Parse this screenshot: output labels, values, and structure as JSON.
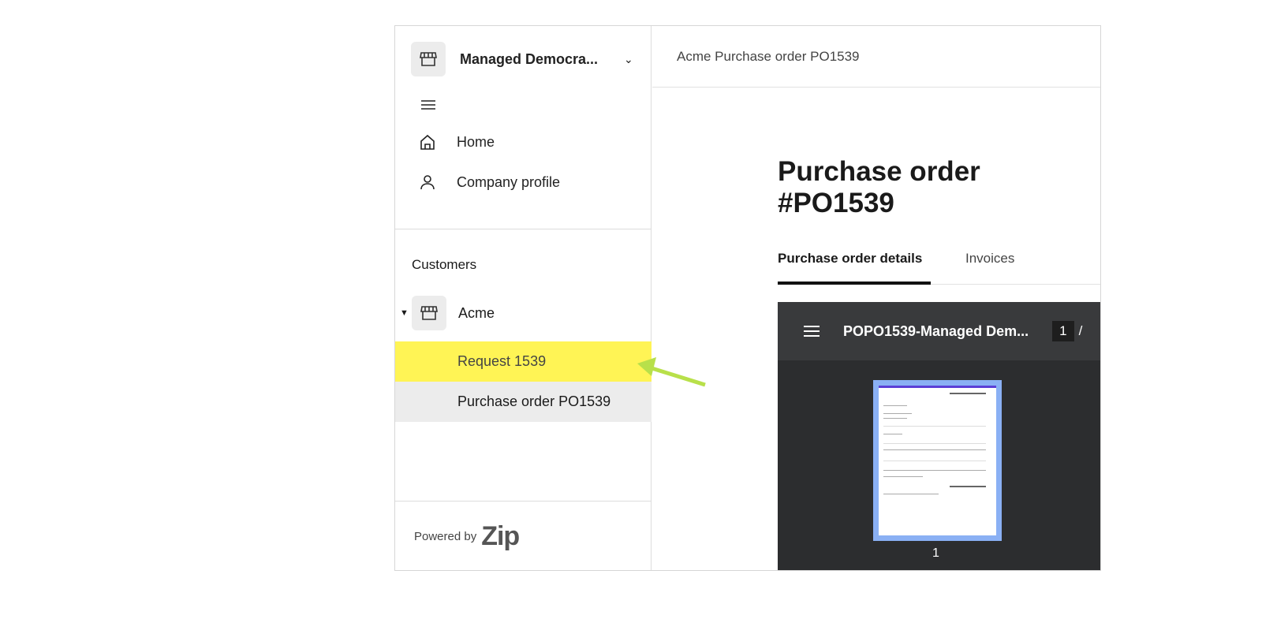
{
  "sidebar": {
    "org_name": "Managed Democra...",
    "nav": [
      {
        "label": "Home",
        "icon": "home-icon"
      },
      {
        "label": "Company profile",
        "icon": "user-icon"
      }
    ],
    "customers_label": "Customers",
    "customer": {
      "label": "Acme",
      "icon": "store-icon"
    },
    "sub_items": [
      {
        "label": "Request 1539",
        "highlight": "#fff455"
      },
      {
        "label": "Purchase order PO1539",
        "selected": true
      }
    ],
    "powered_by": "Powered by",
    "brand": "Zip"
  },
  "header": {
    "breadcrumb": "Acme Purchase order PO1539"
  },
  "main": {
    "title": "Purchase order #PO1539",
    "tabs": [
      {
        "label": "Purchase order details",
        "active": true
      },
      {
        "label": "Invoices"
      }
    ],
    "viewer": {
      "file_name": "POPO1539-Managed Dem...",
      "current_page": "1",
      "page_separator": "/",
      "thumb_page_label": "1"
    }
  },
  "annotation": {
    "arrow_color": "#b8e04a"
  }
}
